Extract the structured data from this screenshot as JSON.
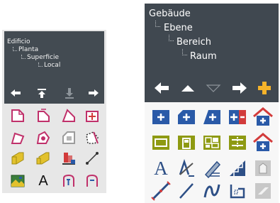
{
  "left_panel": {
    "tree": [
      "Edificio",
      "Planta",
      "Superficie",
      "Local"
    ],
    "nav": [
      "arrow-left-icon",
      "move-to-top-icon",
      "move-down-icon",
      "arrow-right-icon"
    ],
    "tool_text": "A"
  },
  "right_panel": {
    "tree": [
      "Gebäude",
      "Ebene",
      "Bereich",
      "Raum"
    ],
    "nav": [
      "arrow-left-icon",
      "triangle-up-icon",
      "triangle-down-icon",
      "arrow-right-icon",
      "plus-icon"
    ],
    "tool_text": "A"
  },
  "colors": {
    "dark_panel": "#434b52",
    "accent_blue": "#2a5aa8",
    "accent_olive": "#8e9a12",
    "accent_red": "#d23b3b",
    "accent_orange": "#f5b32a"
  }
}
